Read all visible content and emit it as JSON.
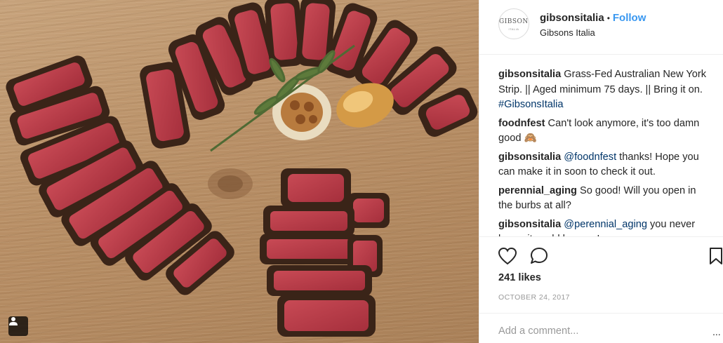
{
  "post": {
    "username": "gibsonsitalia",
    "dot": "•",
    "follow_label": "Follow",
    "location": "Gibsons Italia",
    "avatar_text": "GIBSONS",
    "avatar_subtext": "ITALIA",
    "comments": [
      {
        "user": "gibsonsitalia",
        "text": "Grass-Fed Australian New York Strip. || Aged minimum 75 days. || Bring it on. ",
        "link": "#GibsonsItalia",
        "suffix": ""
      },
      {
        "user": "foodnfest",
        "text": "Can't look anymore, it's too damn good ",
        "link": "",
        "suffix": "🙈"
      },
      {
        "user": "gibsonsitalia",
        "text": " thanks! Hope you can make it in soon to check it out.",
        "link": "@foodnfest",
        "suffix": "",
        "link_first": true
      },
      {
        "user": "perennial_aging",
        "text": "So good! Will you open in the burbs at all?",
        "link": "",
        "suffix": ""
      },
      {
        "user": "gibsonsitalia",
        "text": " you never know, it could happen!",
        "link": "@perennial_aging",
        "suffix": "",
        "link_first": true
      }
    ],
    "likes": "241 likes",
    "date": "OCTOBER 24, 2017",
    "add_comment_placeholder": "Add a comment...",
    "more_label": "..."
  },
  "icons": {
    "like": "heart-icon",
    "comment": "comment-icon",
    "save": "bookmark-icon",
    "user_tag": "user-tag-icon"
  },
  "colors": {
    "follow": "#3897f0",
    "hashtag": "#003569",
    "meta": "#999999"
  }
}
